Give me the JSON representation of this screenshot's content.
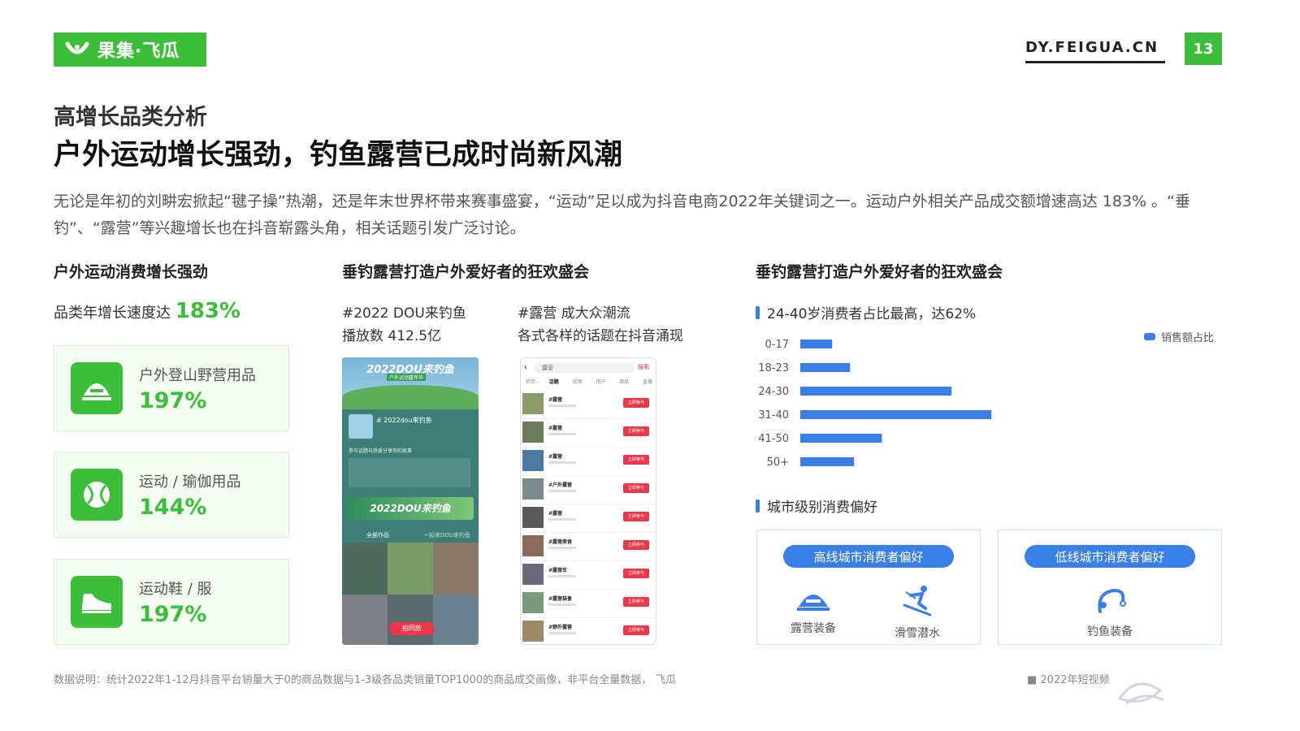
{
  "header": {
    "logo_text": "果集·飞瓜",
    "site": "DY.FEIGUA.CN",
    "page_number": "13"
  },
  "subtitle": "高增长品类分析",
  "title": "户外运动增长强劲，钓鱼露营已成时尚新风潮",
  "intro": "无论是年初的刘畊宏掀起“毽子操”热潮，还是年末世界杯带来赛事盛宴，“运动”足以成为抖音电商2022年关键词之一。运动户外相关产品成交额增速高达 183% 。“垂钓”、“露营”等兴趣增长也在抖音崭露头角，相关话题引发广泛讨论。",
  "col1": {
    "title": "户外运动消费增长强劲",
    "growth_label": "品类年增长速度达",
    "growth_value": "183%",
    "cards": [
      {
        "label": "户外登山野营用品",
        "value": "197%",
        "icon": "tent-icon"
      },
      {
        "label": "运动 / 瑜伽用品",
        "value": "144%",
        "icon": "ball-icon"
      },
      {
        "label": "运动鞋 / 服",
        "value": "197%",
        "icon": "shoe-icon"
      }
    ]
  },
  "col2": {
    "title": "垂钓露营打造户外爱好者的狂欢盛会",
    "caption1_line1": "#2022 DOU来钓鱼",
    "caption1_line2": "播放数 412.5亿",
    "caption2_line1": "#露营 成大众潮流",
    "caption2_line2": "各式各样的话题在抖音涌现",
    "phone1": {
      "banner": "2022DOU来钓鱼",
      "banner_sub": "户外运动嘉年华",
      "hashtag": "# 2022dou来钓鱼",
      "hint": "参与话题与热爱分享你的故事",
      "tabs": [
        "全部作品",
        "一起来DOU来钓鱼"
      ],
      "big_text": "2022DOU来钓鱼",
      "overlay": "拍同款"
    },
    "phone2": {
      "search": "露营",
      "search_btn": "搜索",
      "tabs": [
        "综合",
        "话题",
        "视频",
        "用户",
        "商品",
        "直播"
      ],
      "rows": [
        {
          "name": "#露营",
          "btn": "立即参与"
        },
        {
          "name": "#露营",
          "btn": "立即参与"
        },
        {
          "name": "#露营",
          "btn": "立即参与"
        },
        {
          "name": "#户外露营",
          "btn": "立即参与"
        },
        {
          "name": "#露营",
          "btn": "立即参与"
        },
        {
          "name": "#露营美食",
          "btn": "立即参与"
        },
        {
          "name": "#露营车",
          "btn": "立即参与"
        },
        {
          "name": "#露营装备",
          "btn": "立即参与"
        },
        {
          "name": "#野外露营",
          "btn": "立即参与"
        }
      ]
    }
  },
  "col3": {
    "title": "垂钓露营打造户外爱好者的狂欢盛会",
    "age_heading": "24-40岁消费者占比最高，达62%",
    "city_heading": "城市级别消费偏好",
    "high_tier": {
      "label": "高线城市消费者偏好",
      "items": [
        {
          "name": "露营装备",
          "icon": "tent-icon"
        },
        {
          "name": "滑雪潜水",
          "icon": "skier-icon"
        }
      ]
    },
    "low_tier": {
      "label": "低线城市消费者偏好",
      "items": [
        {
          "name": "钓鱼装备",
          "icon": "fishing-icon"
        }
      ]
    }
  },
  "chart_data": {
    "type": "bar",
    "orientation": "horizontal",
    "categories": [
      "0-17",
      "18-23",
      "24-30",
      "31-40",
      "41-50",
      "50+"
    ],
    "series": [
      {
        "name": "销售额占比",
        "values": [
          0.08,
          0.125,
          0.38,
          0.48,
          0.205,
          0.135
        ]
      }
    ],
    "legend": "top-right",
    "color": "#3a7fe6",
    "grid": false
  },
  "footer": {
    "note": "数据说明：统计2022年1-12月抖音平台销量大于0的商品数据与1-3级各品类销量TOP1000的商品成交画像，非平台全量数据， 飞瓜",
    "right": "■  2022年短视频"
  },
  "colors": {
    "green": "#3dbe3a",
    "blue": "#3a7fe6"
  }
}
